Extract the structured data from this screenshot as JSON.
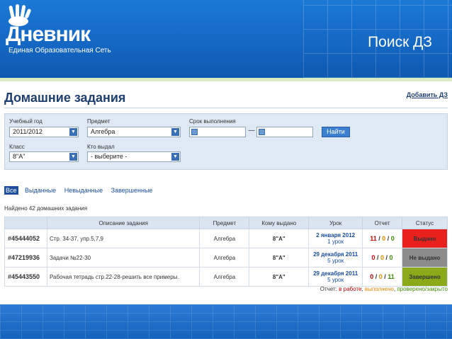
{
  "logo": {
    "text": "Дневник",
    "subtitle": "Единая Образовательная Сеть"
  },
  "slide_title": "Поиск ДЗ",
  "page": {
    "title": "Домашние задания",
    "add_link": "Добавить ДЗ"
  },
  "filters": {
    "year_label": "Учебный год",
    "year_value": "2011/2012",
    "subject_label": "Предмет",
    "subject_value": "Алгебра",
    "deadline_label": "Срок выполнения",
    "deadline_sep": "—",
    "class_label": "Класс",
    "class_value": "8\"А\"",
    "issuer_label": "Кто выдал",
    "issuer_value": "- выберите -",
    "find_button": "Найти"
  },
  "tabs": [
    "Все",
    "Выданные",
    "Невыданные",
    "Завершенные"
  ],
  "found_text": "Найдено 42 домашних задания",
  "table": {
    "headers": [
      "",
      "Описание задания",
      "Предмет",
      "Кому выдано",
      "Урок",
      "Отчет",
      "Статус"
    ],
    "rows": [
      {
        "id": "#45444052",
        "desc": "Стр. 34-37, упр.5,7,9",
        "subject": "Алгебра",
        "class": "8\"А\"",
        "lesson_date": "2 января 2012",
        "lesson_num": "1 урок",
        "r1": "11",
        "r2": "0",
        "r3": "0",
        "sep": " / ",
        "status": "Выдано",
        "status_color": "#e8211f"
      },
      {
        "id": "#47219936",
        "desc": "Задачи №22-30",
        "subject": "Алгебра",
        "class": "8\"А\"",
        "lesson_date": "29 декабря 2011",
        "lesson_num": "5 урок",
        "r1": "0",
        "r2": "0",
        "r3": "0",
        "sep": " / ",
        "status": "Не выдано",
        "status_color": "#8c8c8c"
      },
      {
        "id": "#45443550",
        "desc": "Рабочая тетрадь стр.22-28-решить все примеры.",
        "subject": "Алгебра",
        "class": "8\"А\"",
        "lesson_date": "29 декабря 2011",
        "lesson_num": "5 урок",
        "r1": "0",
        "r2": "0",
        "r3": "11",
        "sep": " / ",
        "status": "Завершено",
        "status_color": "#8aaa1a"
      }
    ]
  },
  "legend": {
    "prefix": "Отчет: ",
    "in_work": "в работе",
    "sep1": ", ",
    "done": "выполнено",
    "sep2": ", ",
    "checked": "проверено/закрыто"
  },
  "colors": {
    "header_blue": "#1466c2",
    "in_work": "#c00000",
    "done": "#e08a00",
    "checked": "#3f8a00"
  }
}
